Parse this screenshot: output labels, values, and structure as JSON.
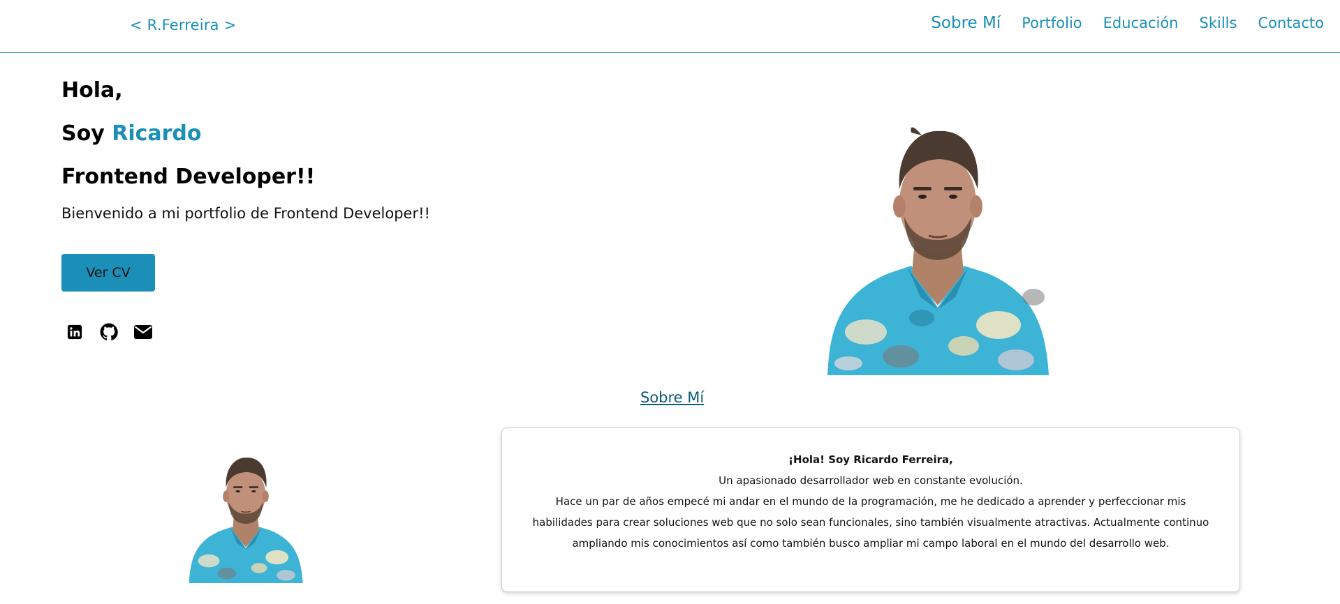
{
  "header": {
    "brand": "< R.Ferreira >",
    "nav": [
      {
        "label": "Sobre Mí",
        "active": true
      },
      {
        "label": "Portfolio",
        "active": false
      },
      {
        "label": "Educación",
        "active": false
      },
      {
        "label": "Skills",
        "active": false
      },
      {
        "label": "Contacto",
        "active": false
      }
    ]
  },
  "hero": {
    "line1": "Hola,",
    "line2_prefix": "Soy ",
    "line2_name": "Ricardo",
    "line3": "Frontend Developer!!",
    "subtitle": "Bienvenido a mi portfolio de Frontend Developer!!",
    "cv_button": "Ver CV",
    "social_icons": [
      "linkedin-icon",
      "github-icon",
      "envelope-icon"
    ]
  },
  "about": {
    "title": "Sobre Mí",
    "greeting": "¡Hola! Soy Ricardo Ferreira,",
    "line1": "Un apasionado desarrollador web en constante evolución.",
    "paragraph": "Hace un par de años empecé mi andar en el mundo de la programación, me he dedicado a aprender y perfeccionar mis habilidades para crear soluciones web que no solo sean funcionales, sino también visualmente atractivas. Actualmente continuo ampliando mis conocimientos así como también busco ampliar mi campo laboral en el mundo del desarrollo web."
  },
  "colors": {
    "accent": "#1b8fb8",
    "link_dark": "#0c5a7a",
    "shirt_blue": "#3db4d6"
  }
}
